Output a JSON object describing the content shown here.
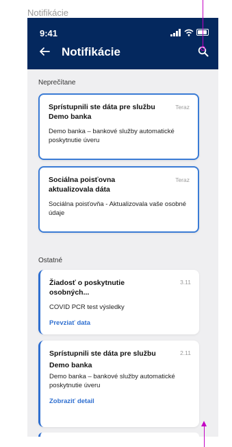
{
  "frame_title": "Notifikácie",
  "status_bar": {
    "time": "9:41"
  },
  "header": {
    "title": "Notifikácie"
  },
  "sections": {
    "unread_label": "Neprečítane",
    "other_label": "Ostatné"
  },
  "cards": [
    {
      "title": "Sprístupnili ste dáta pre službu Demo banka",
      "time": "Teraz",
      "body": "Demo banka – bankové služby automatické poskytnutie úveru"
    },
    {
      "title": "Sociálna poisťovna aktualizovala dáta",
      "time": "Teraz",
      "body": "Sociálna poisťovňa - Aktualizovala vaše osobné údaje"
    },
    {
      "title": "Žiadosť o poskytnutie osobných...",
      "time": "3.11",
      "body": "COVID PCR test výsledky",
      "link": "Prevziať data"
    },
    {
      "title": "Sprístupnili ste dáta pre službu",
      "title2": "Demo banka",
      "time": "2.11",
      "body": "Demo banka – bankové služby automatické poskytnutie úveru",
      "link": "Zobraziť detail"
    }
  ],
  "icons": {
    "back": "arrow-left-icon",
    "search": "search-icon",
    "signal": "signal-icon",
    "wifi": "wifi-icon",
    "battery": "battery-icon"
  },
  "colors": {
    "header_bg": "#04285e",
    "accent": "#2f6fd0",
    "annotation": "#c300c3"
  }
}
